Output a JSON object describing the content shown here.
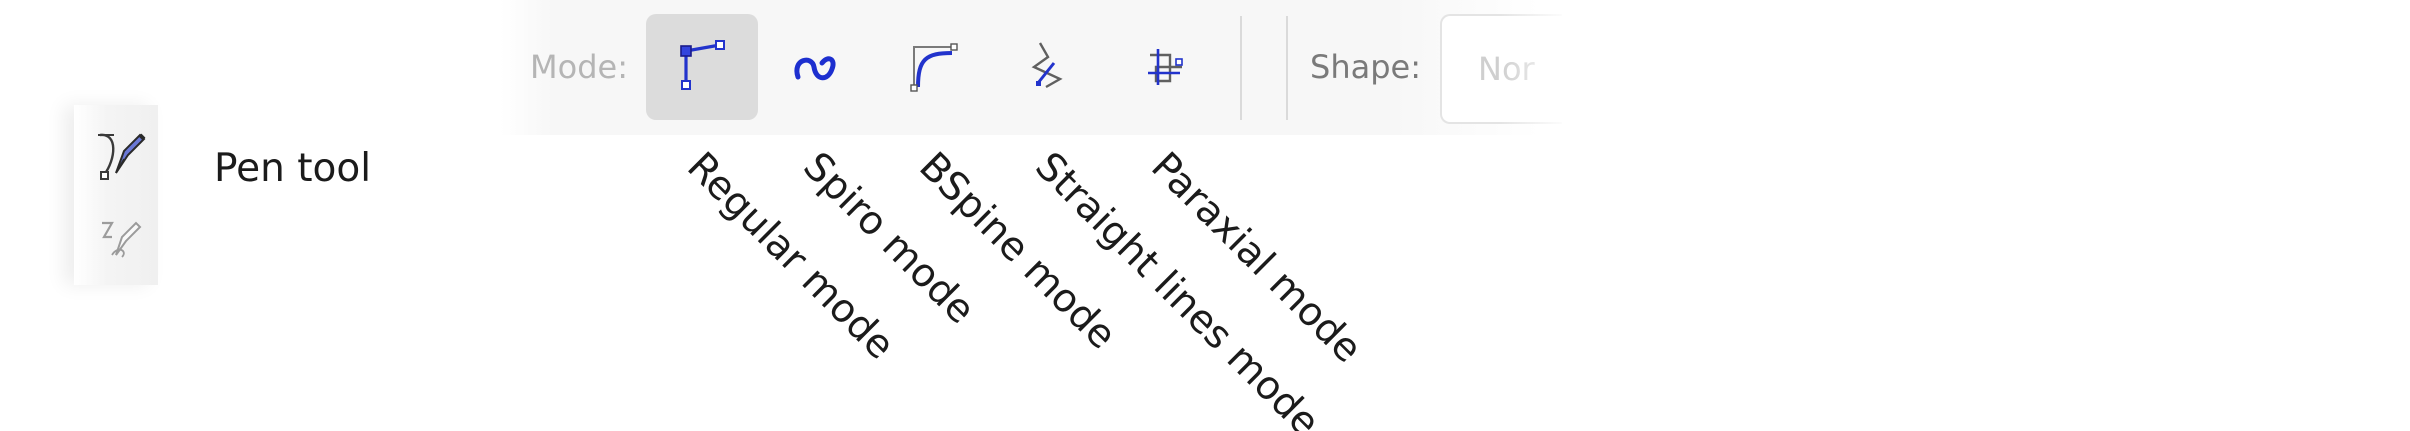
{
  "toolbox": {
    "pen_tool_icon": "pen-bezier-icon",
    "pencil_tool_icon": "pencil-icon"
  },
  "callouts": {
    "pen_tool": "Pen tool",
    "regular": "Regular mode",
    "spiro": "Spiro mode",
    "bspine": "BSpine mode",
    "straight": "Straight lines mode",
    "paraxial": "Paraxial mode"
  },
  "controls": {
    "mode_label": "Mode:",
    "modes": [
      {
        "id": "regular",
        "icon": "regular-bezier-icon",
        "active": true
      },
      {
        "id": "spiro",
        "icon": "spiro-icon",
        "active": false
      },
      {
        "id": "bspline",
        "icon": "bspline-icon",
        "active": false
      },
      {
        "id": "straight",
        "icon": "zigzag-icon",
        "active": false
      },
      {
        "id": "paraxial",
        "icon": "paraxial-icon",
        "active": false
      }
    ],
    "shape_label": "Shape:",
    "shape_value": "Nor"
  },
  "colors": {
    "icon_blue": "#2233cc",
    "icon_grey": "#606060",
    "active_bg": "#dcdcdc",
    "bar_bg": "#f7f7f7"
  }
}
